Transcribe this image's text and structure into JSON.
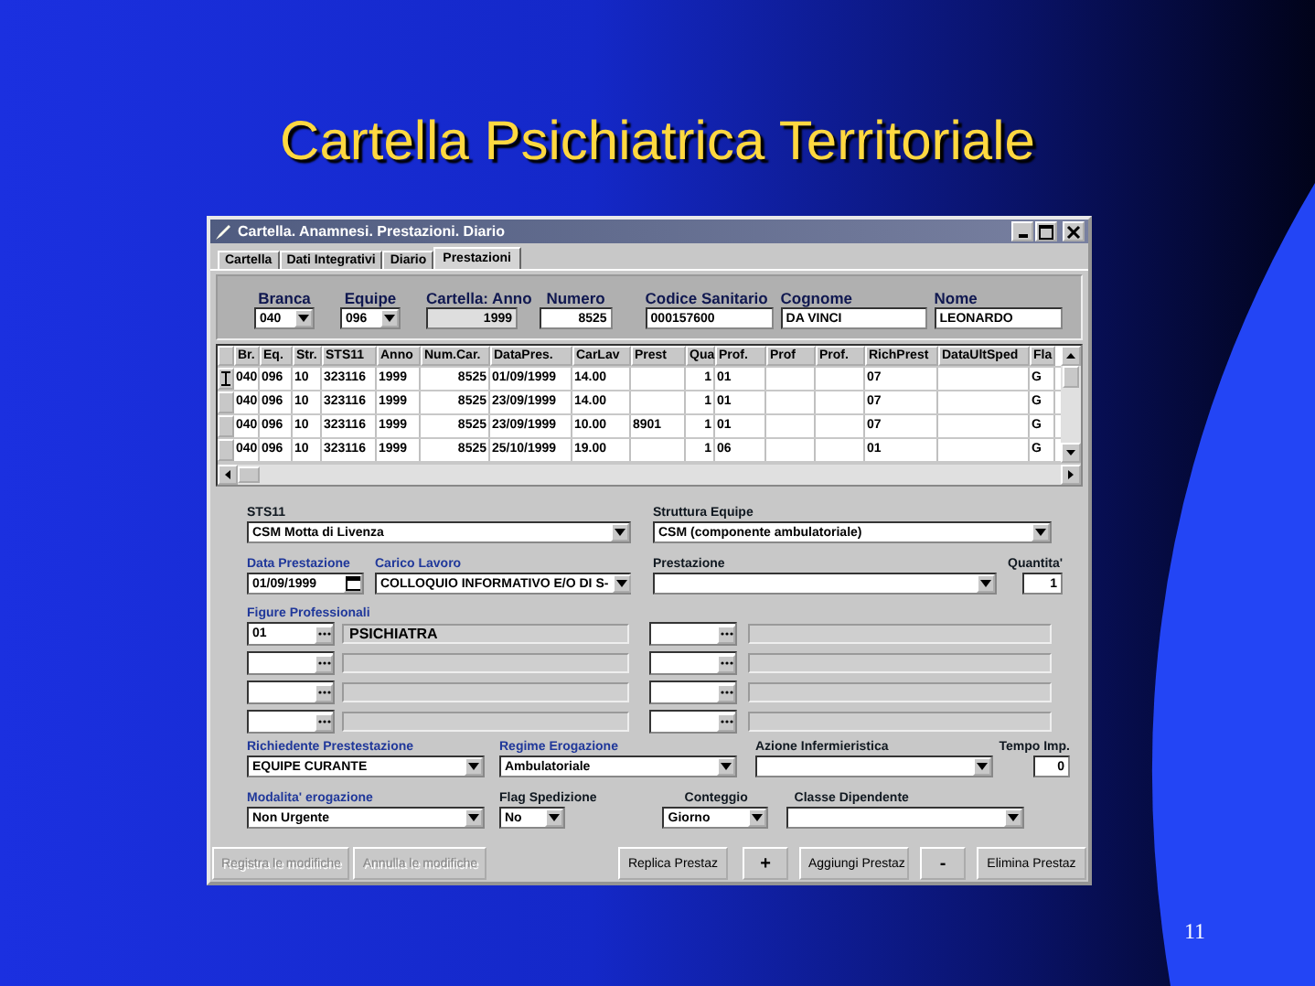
{
  "slide": {
    "title": "Cartella Psichiatrica Territoriale",
    "page_number": "11"
  },
  "window": {
    "title": "Cartella. Anamnesi. Prestazioni. Diario"
  },
  "tabs": [
    {
      "label": "Cartella",
      "selected": false
    },
    {
      "label": "Dati Integrativi",
      "selected": false
    },
    {
      "label": "Diario",
      "selected": false
    },
    {
      "label": "Prestazioni",
      "selected": true
    }
  ],
  "header_fields": [
    {
      "label": "Branca",
      "value": "040",
      "kind": "combo"
    },
    {
      "label": "Equipe",
      "value": "096",
      "kind": "combo"
    },
    {
      "label": "Cartella: Anno",
      "value": "1999",
      "kind": "readonly"
    },
    {
      "label": "Numero",
      "value": "8525",
      "kind": "number"
    },
    {
      "label": "Codice Sanitario",
      "value": "000157600",
      "kind": "text"
    },
    {
      "label": "Cognome",
      "value": "DA VINCI",
      "kind": "text"
    },
    {
      "label": "Nome",
      "value": "LEONARDO",
      "kind": "text"
    }
  ],
  "table": {
    "columns": [
      "Br.",
      "Eq.",
      "Str.",
      "STS11",
      "Anno",
      "Num.Car.",
      "DataPres.",
      "CarLav",
      "Prest",
      "Qua",
      "Prof.",
      "Prof",
      "Prof.",
      "RichPrest",
      "DataUltSped",
      "Fla"
    ],
    "rows": [
      {
        "current": true,
        "cells": [
          "040",
          "096",
          "10",
          "323116",
          "1999",
          "8525",
          "01/09/1999",
          "14.00",
          null,
          "1",
          "01",
          null,
          null,
          "07",
          null,
          "G"
        ]
      },
      {
        "current": false,
        "cells": [
          "040",
          "096",
          "10",
          "323116",
          "1999",
          "8525",
          "23/09/1999",
          "14.00",
          null,
          "1",
          "01",
          null,
          null,
          "07",
          null,
          "G"
        ]
      },
      {
        "current": false,
        "cells": [
          "040",
          "096",
          "10",
          "323116",
          "1999",
          "8525",
          "23/09/1999",
          "10.00",
          "8901",
          "1",
          "01",
          null,
          null,
          "07",
          null,
          "G"
        ]
      },
      {
        "current": false,
        "cells": [
          "040",
          "096",
          "10",
          "323116",
          "1999",
          "8525",
          "25/10/1999",
          "19.00",
          null,
          "1",
          "06",
          null,
          null,
          "01",
          null,
          "G"
        ]
      }
    ]
  },
  "form": {
    "row_1": [
      {
        "label": "STS11",
        "value": "CSM Motta di Livenza",
        "kind": "combo",
        "required": false
      },
      {
        "label": "Struttura Equipe",
        "value": "CSM (componente ambulatoriale)",
        "kind": "combo",
        "required": false
      }
    ],
    "row_2": [
      {
        "label": "Data Prestazione",
        "value": "01/09/1999",
        "kind": "date",
        "required": true
      },
      {
        "label": "Carico Lavoro",
        "value": "COLLOQUIO INFORMATIVO E/O DI S-",
        "kind": "combo",
        "required": true
      },
      {
        "label": "Prestazione",
        "kind": "combo",
        "required": false
      },
      {
        "label": "Quantita'",
        "value": "1",
        "kind": "number",
        "required": false
      }
    ],
    "professionals_label": "Figure Professionali",
    "professionals": [
      {
        "code": "01",
        "description": "PSICHIATRA"
      }
    ],
    "row_3": [
      {
        "label": "Richiedente Prestestazione",
        "value": "EQUIPE CURANTE",
        "kind": "combo",
        "required": true
      },
      {
        "label": "Regime Erogazione",
        "value": "Ambulatoriale",
        "kind": "combo",
        "required": true
      },
      {
        "label": "Azione Infermieristica",
        "kind": "combo",
        "required": false
      },
      {
        "label": "Tempo Imp.",
        "value": "0",
        "kind": "number",
        "required": false
      }
    ],
    "row_4": [
      {
        "label": "Modalita' erogazione",
        "value": "Non Urgente",
        "kind": "combo",
        "required": true
      },
      {
        "label": "Flag Spedizione",
        "value": "No",
        "kind": "combo",
        "required": false
      },
      {
        "label": "Conteggio",
        "value": "Giorno",
        "kind": "combo",
        "required": false
      },
      {
        "label": "Classe Dipendente",
        "kind": "combo",
        "required": false
      }
    ]
  },
  "buttons": [
    {
      "label": "Registra le modifiche",
      "disabled": true
    },
    {
      "label": "Annulla le modifiche",
      "disabled": true
    },
    {
      "label": "Replica Prestaz",
      "disabled": false
    },
    {
      "label": "+",
      "disabled": false
    },
    {
      "label": "Aggiungi Prestaz",
      "disabled": false
    },
    {
      "label": "-",
      "disabled": false
    },
    {
      "label": "Elimina Prestaz",
      "disabled": false
    }
  ]
}
